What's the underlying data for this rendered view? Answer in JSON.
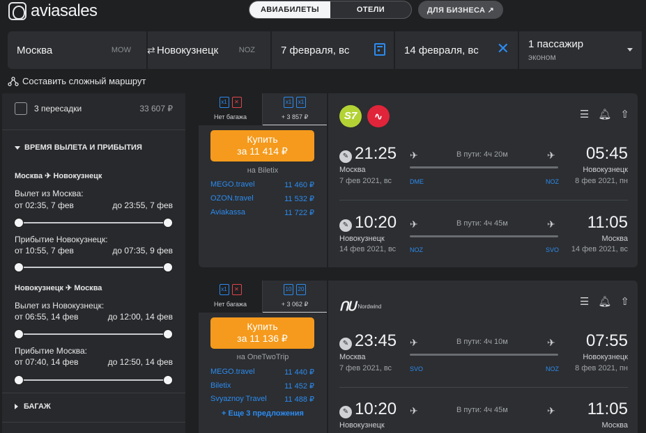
{
  "header": {
    "logo_text": "aviasales",
    "tab_flights": "АВИАБИЛЕТЫ",
    "tab_hotels": "ОТЕЛИ",
    "business": "ДЛЯ БИЗНЕСА ↗"
  },
  "search": {
    "origin": "Москва",
    "origin_code": "MOW",
    "destination": "Новокузнецк",
    "destination_code": "NOZ",
    "depart_date": "7 февраля, вс",
    "return_date": "14 февраля, вс",
    "passengers": "1 пассажир",
    "cabin": "эконом",
    "complex_route": "Составить сложный маршрут"
  },
  "sidebar": {
    "stops_label": "3 пересадки",
    "stops_price": "33 607 ₽",
    "times_header": "ВРЕМЯ ВЫЛЕТА И ПРИБЫТИЯ",
    "leg1_from": "Москва",
    "leg1_to": "Новокузнецк",
    "leg1_dep_label": "Вылет из Москва:",
    "leg1_dep_from": "от 02:35, 7 фев",
    "leg1_dep_to": "до 23:55, 7 фев",
    "leg1_arr_label": "Прибытие Новокузнецк:",
    "leg1_arr_from": "от 10:55, 7 фев",
    "leg1_arr_to": "до 07:35, 9 фев",
    "leg2_from": "Новокузнецк",
    "leg2_to": "Москва",
    "leg2_dep_label": "Вылет из Новокузнецк:",
    "leg2_dep_from": "от 06:55, 14 фев",
    "leg2_dep_to": "до 12:00, 14 фев",
    "leg2_arr_label": "Прибытие Москва:",
    "leg2_arr_from": "от 07:40, 14 фев",
    "leg2_arr_to": "до 12:50, 14 фев",
    "baggage_header": "БАГАЖ"
  },
  "tickets": [
    {
      "tab_nobag": "Нет багажа",
      "tab_bag_price": "+ 3 857 ₽",
      "buy_label": "Купить",
      "buy_price": "за 11 414 ₽",
      "via": "на Biletix",
      "agencies": [
        {
          "name": "MEGO.travel",
          "price": "11 460 ₽"
        },
        {
          "name": "OZON.travel",
          "price": "11 532 ₽"
        },
        {
          "name": "Aviakassa",
          "price": "11 722 ₽"
        }
      ],
      "airline": "S7",
      "outbound": {
        "dep_time": "21:25",
        "arr_time": "05:45",
        "dep_city": "Москва",
        "arr_city": "Новокузнецк",
        "dep_date": "7 фев 2021, вс",
        "arr_date": "8 фев 2021, пн",
        "duration": "В пути: 4ч 20м",
        "dep_apt": "DME",
        "arr_apt": "NOZ"
      },
      "inbound": {
        "dep_time": "10:20",
        "arr_time": "11:05",
        "dep_city": "Новокузнецк",
        "arr_city": "Москва",
        "dep_date": "14 фев 2021, вс",
        "arr_date": "14 фев 2021, вс",
        "duration": "В пути: 4ч 45м",
        "dep_apt": "NOZ",
        "arr_apt": "SVO"
      }
    },
    {
      "tab_nobag": "Нет багажа",
      "tab_bag_price": "+ 3 062 ₽",
      "buy_label": "Купить",
      "buy_price": "за 11 136 ₽",
      "via": "на OneTwoTrip",
      "agencies": [
        {
          "name": "MEGO.travel",
          "price": "11 440 ₽"
        },
        {
          "name": "Biletix",
          "price": "11 452 ₽"
        },
        {
          "name": "Svyaznoy Travel",
          "price": "11 488 ₽"
        }
      ],
      "more": "+ Еще 3 предложения",
      "airline_text": "Nordwind",
      "outbound": {
        "dep_time": "23:45",
        "arr_time": "07:55",
        "dep_city": "Москва",
        "arr_city": "Новокузнецк",
        "dep_date": "7 фев 2021, вс",
        "arr_date": "8 фев 2021, пн",
        "duration": "В пути: 4ч 10м",
        "dep_apt": "SVO",
        "arr_apt": "NOZ"
      },
      "inbound": {
        "dep_time": "10:20",
        "arr_time": "11:05",
        "dep_city": "Новокузнецк",
        "arr_city": "Москва",
        "duration": "В пути: 4ч 45м"
      }
    }
  ]
}
